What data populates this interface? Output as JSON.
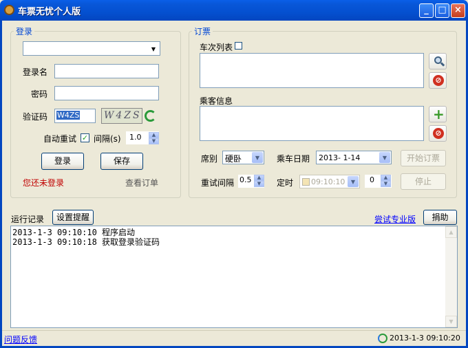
{
  "window": {
    "title": "车票无忧个人版",
    "minimize_label": "_",
    "maximize_label": "□",
    "close_label": "×"
  },
  "login": {
    "group_title": "登录",
    "account_combo_value": "",
    "username_label": "登录名",
    "username_value": "",
    "password_label": "密码",
    "password_value": "",
    "captcha_label": "验证码",
    "captcha_value": "W4ZS",
    "captcha_image_text": "W4ZS",
    "auto_retry_label": "自动重试",
    "auto_retry_checked": true,
    "interval_label": "间隔(s)",
    "interval_value": "1.0",
    "login_button": "登录",
    "save_button": "保存",
    "status_text": "您还未登录",
    "view_orders_link": "查看订单"
  },
  "booking": {
    "group_title": "订票",
    "train_list_label": "车次列表",
    "passenger_label": "乘客信息",
    "seat_label": "席别",
    "seat_value": "硬卧",
    "date_label": "乘车日期",
    "date_value": "2013- 1-14",
    "start_button": "开始订票",
    "retry_interval_label": "重试间隔",
    "retry_interval_value": "0.5",
    "timer_label": "定时",
    "timer_value": "09:10:10",
    "timer_extra_value": "0",
    "stop_button": "停止"
  },
  "log": {
    "label": "运行记录",
    "reminder_button": "设置提醒",
    "pro_link": "尝试专业版",
    "donate_button": "捐助",
    "entries": [
      "2013-1-3 09:10:10 程序启动",
      "2013-1-3 09:10:18 获取登录验证码"
    ]
  },
  "statusbar": {
    "feedback_link": "问题反馈",
    "datetime": "2013-1-3 09:10:20"
  },
  "colors": {
    "titlebar": "#0450d0",
    "legend": "#0046d5",
    "status_red": "#c00000",
    "window_bg": "#ece9d8"
  }
}
